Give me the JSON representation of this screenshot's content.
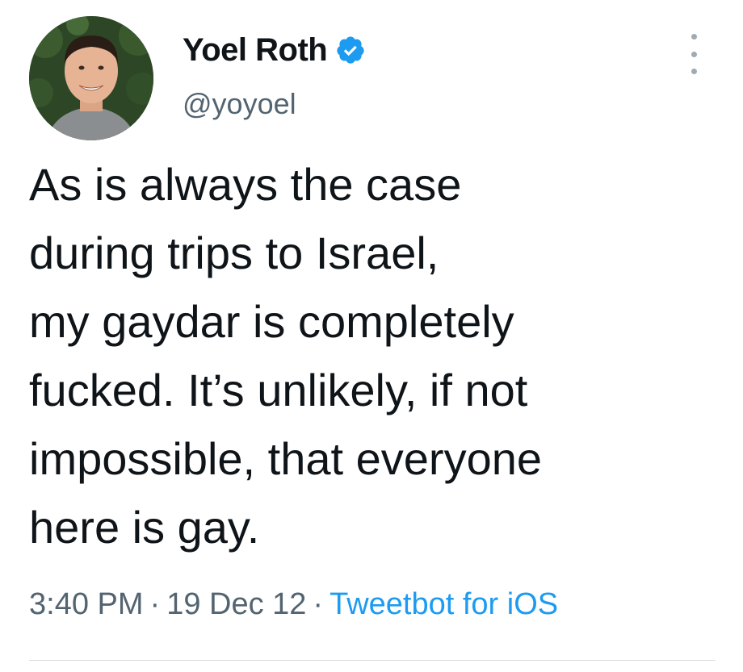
{
  "user": {
    "display_name": "Yoel Roth",
    "handle": "@yoyoel",
    "verified": true
  },
  "tweet": {
    "lines": [
      "As is always the case",
      "during trips to Israel,",
      "my gaydar is completely",
      "fucked. It’s unlikely, if not",
      "impossible, that everyone",
      "here is gay."
    ],
    "time": "3:40 PM",
    "separator": "·",
    "date": "19 Dec 12",
    "source": "Tweetbot for iOS"
  },
  "icons": {
    "verified": "verified-badge-icon",
    "more": "more-options-icon"
  },
  "colors": {
    "accent": "#1d9bf0",
    "text": "#0f1419",
    "muted": "#536471"
  }
}
